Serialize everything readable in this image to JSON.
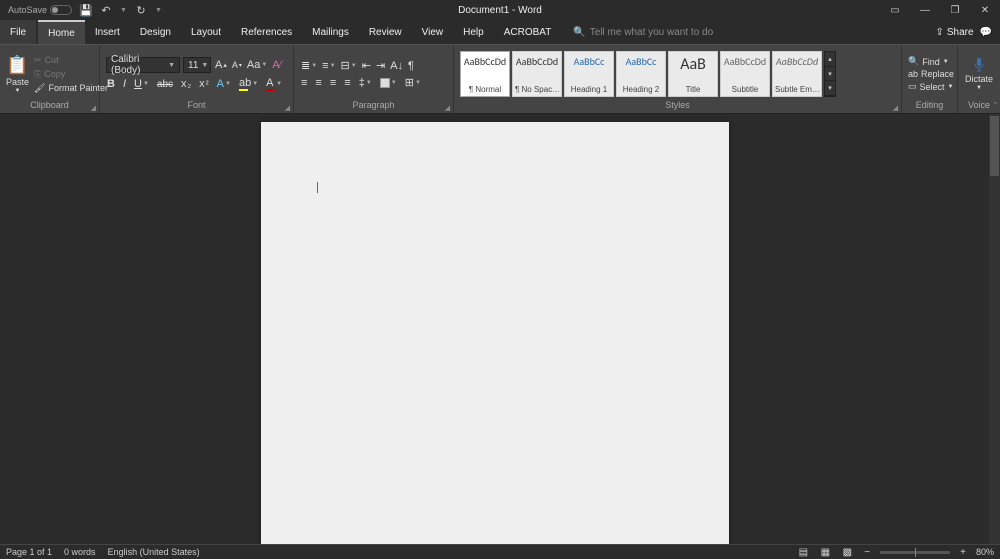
{
  "titlebar": {
    "autosave_label": "AutoSave",
    "title": "Document1 - Word"
  },
  "menu": {
    "file": "File",
    "home": "Home",
    "insert": "Insert",
    "design": "Design",
    "layout": "Layout",
    "references": "References",
    "mailings": "Mailings",
    "review": "Review",
    "view": "View",
    "help": "Help",
    "acrobat": "ACROBAT",
    "tellme": "Tell me what you want to do",
    "share": "Share"
  },
  "ribbon": {
    "clipboard": {
      "paste": "Paste",
      "cut": "Cut",
      "copy": "Copy",
      "format_painter": "Format Painter",
      "group_label": "Clipboard"
    },
    "font": {
      "font_name": "Calibri (Body)",
      "font_size": "11",
      "group_label": "Font"
    },
    "paragraph": {
      "group_label": "Paragraph"
    },
    "styles": {
      "sample": "AaBbCcDd",
      "sample_h": "AaBbCc",
      "sample_title": "AaB",
      "items": {
        "normal": "¶ Normal",
        "nospace": "¶ No Spac…",
        "heading1": "Heading 1",
        "heading2": "Heading 2",
        "title": "Title",
        "subtitle": "Subtitle",
        "subtle_em": "Subtle Em…"
      },
      "group_label": "Styles"
    },
    "editing": {
      "find": "Find",
      "replace": "Replace",
      "select": "Select",
      "group_label": "Editing"
    },
    "voice": {
      "dictate": "Dictate",
      "group_label": "Voice"
    }
  },
  "statusbar": {
    "page": "Page 1 of 1",
    "words": "0 words",
    "language": "English (United States)",
    "zoom": "80%"
  }
}
